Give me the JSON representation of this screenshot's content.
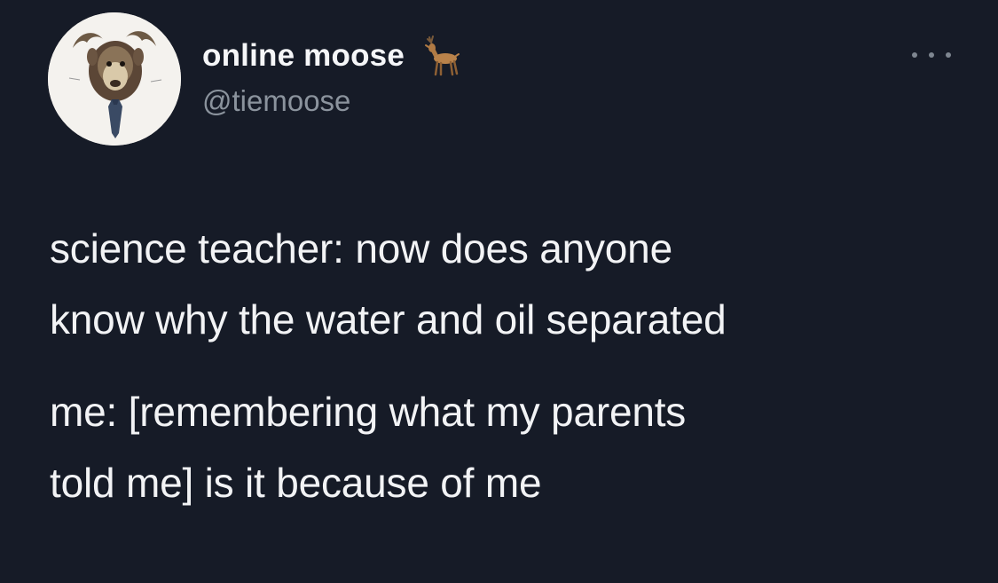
{
  "author": {
    "display_name": "online moose",
    "name_emoji_icon": "deer-icon",
    "handle": "@tiemoose",
    "avatar_icon": "moose-with-tie-avatar"
  },
  "menu": {
    "icon": "more-options-icon"
  },
  "tweet": {
    "lines": [
      "science teacher: now does anyone",
      "know why the water and oil separated",
      "me: [remembering what my parents",
      "told me] is it because of me"
    ]
  },
  "colors": {
    "background": "#161b27",
    "text": "#f2f3f5",
    "handle": "#8b939d"
  }
}
